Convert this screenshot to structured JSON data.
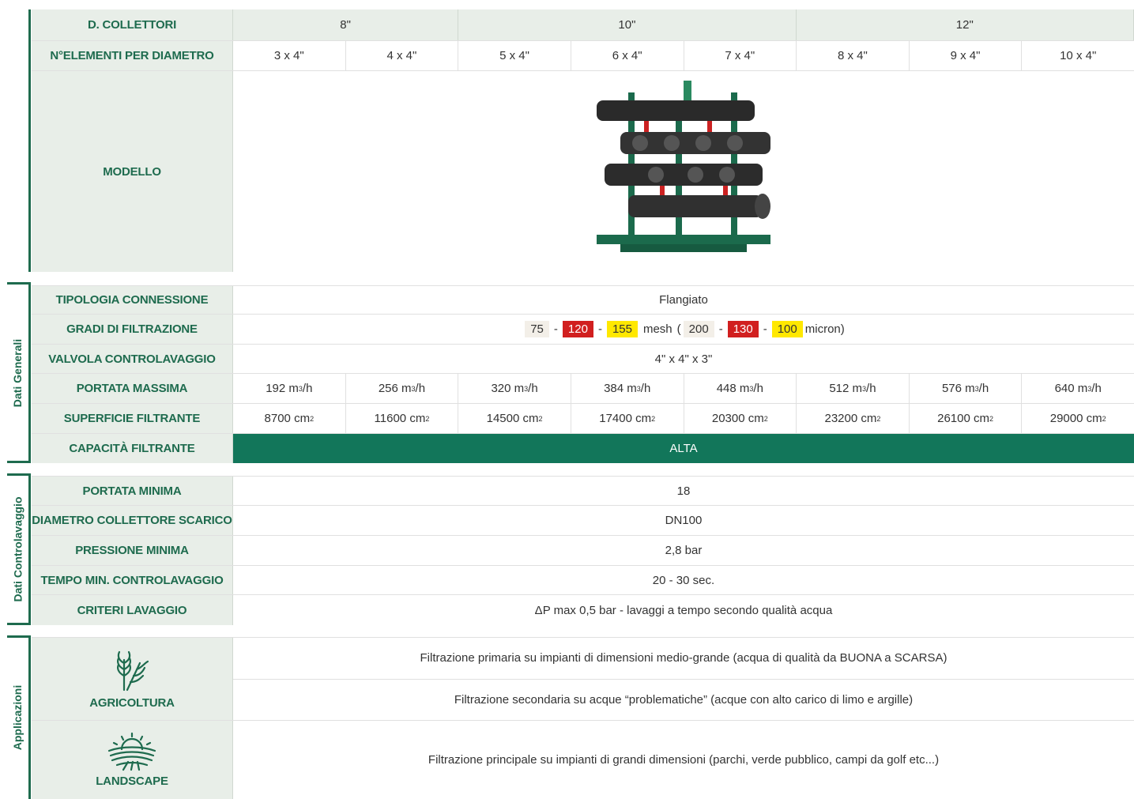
{
  "header": {
    "row1_label": "D. COLLETTORI",
    "diameters": [
      "8\"",
      "10\"",
      "12\""
    ],
    "row2_label": "N°ELEMENTI PER DIAMETRO",
    "elements": [
      "3 x 4\"",
      "4 x 4\"",
      "5 x 4\"",
      "6 x 4\"",
      "7 x 4\"",
      "8 x 4\"",
      "9 x 4\"",
      "10 x 4\""
    ],
    "model_label": "MODELLO"
  },
  "dati_generali": {
    "section_label": "Dati Generali",
    "connessione_label": "TIPOLOGIA CONNESSIONE",
    "connessione_value": "Flangiato",
    "filtrazione_label": "GRADI DI FILTRAZIONE",
    "filtrazione": {
      "mesh": [
        "75",
        "120",
        "155"
      ],
      "mesh_unit": "mesh",
      "micron": [
        "200",
        "130",
        "100"
      ],
      "micron_unit": "micron)",
      "open_paren": "(",
      "dash": "-",
      "colors": [
        "#f3efe8",
        "#d11f1f",
        "#ffe800"
      ]
    },
    "valvola_label": "VALVOLA CONTROLAVAGGIO",
    "valvola_value": "4\" x 4\" x 3\"",
    "portata_label": "PORTATA MASSIMA",
    "portata_values": [
      "192 m",
      "256 m",
      "320 m",
      "384 m",
      "448 m",
      "512 m",
      "576 m",
      "640 m"
    ],
    "portata_unit_sup": "3",
    "portata_unit_tail": "/h",
    "superficie_label": "SUPERFICIE FILTRANTE",
    "superficie_values": [
      "8700 cm",
      "11600 cm",
      "14500 cm",
      "17400 cm",
      "20300 cm",
      "23200 cm",
      "26100 cm",
      "29000 cm"
    ],
    "superficie_sup": "2",
    "capacita_label": "CAPACITÀ FILTRANTE",
    "capacita_value": "ALTA"
  },
  "dati_controlavaggio": {
    "section_label": "Dati Controlavaggio",
    "portata_min_label": "PORTATA MINIMA",
    "portata_min_value": "18",
    "diametro_label": "DIAMETRO COLLETTORE SCARICO",
    "diametro_value": "DN100",
    "pressione_label": "PRESSIONE MINIMA",
    "pressione_value": "2,8 bar",
    "tempo_label": "TEMPO MIN. CONTROLAVAGGIO",
    "tempo_value": "20 - 30 sec.",
    "criteri_label": "CRITERI LAVAGGIO",
    "criteri_value": "ΔP max 0,5 bar - lavaggi a tempo secondo qualità acqua"
  },
  "applicazioni": {
    "section_label": "Applicazioni",
    "agricoltura_label": "AGRICOLTURA",
    "agricoltura_text1": "Filtrazione primaria su impianti di dimensioni medio-grande (acqua di qualità da BUONA a SCARSA)",
    "agricoltura_text2": "Filtrazione secondaria su acque “problematiche” (acque con alto carico di limo e argille)",
    "landscape_label": "LANDSCAPE",
    "landscape_text": "Filtrazione principale su impianti di grandi dimensioni (parchi, verde pubblico, campi da golf etc...)"
  },
  "colors": {
    "brand_green": "#1e6b4e",
    "alta_green": "#12765a",
    "label_bg": "#e8eee8"
  }
}
